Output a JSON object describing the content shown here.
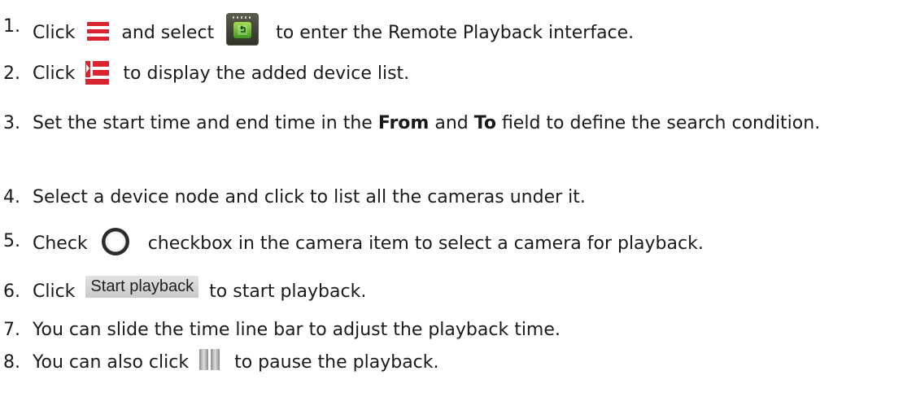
{
  "steps": [
    {
      "num": "1.",
      "before_icon": "Click",
      "icon1": "hamburger-menu-icon",
      "middle": "and select",
      "icon2": "remote-playback-icon",
      "after": "to enter the Remote Playback interface."
    },
    {
      "num": "2.",
      "before_icon": "Click",
      "icon": "device-list-icon",
      "after": "to display the added device list."
    },
    {
      "num": "3.",
      "part1": "Set the start time and end time in the",
      "bold1": "From",
      "part2": "and",
      "bold2": "To",
      "part3": "field to define the search condition."
    },
    {
      "num": "4.",
      "text": "Select a device node and click to list all the cameras under it."
    },
    {
      "num": "5.",
      "before_icon": "Check",
      "icon": "round-checkbox-icon",
      "after": "checkbox in the camera item to select a camera for playback."
    },
    {
      "num": "6.",
      "before_icon": "Click",
      "button_label": "Start playback",
      "after": "to start playback."
    },
    {
      "num": "7.",
      "text": "You can slide the time line bar to adjust the playback time."
    },
    {
      "num": "8.",
      "before_icon": "You can also click",
      "icon": "pause-icon",
      "after": "to pause the playback."
    }
  ],
  "colors": {
    "menu_icon": "#d9232e",
    "playback_icon": "#5fb52a",
    "button_bg": "#d4d4d4"
  }
}
